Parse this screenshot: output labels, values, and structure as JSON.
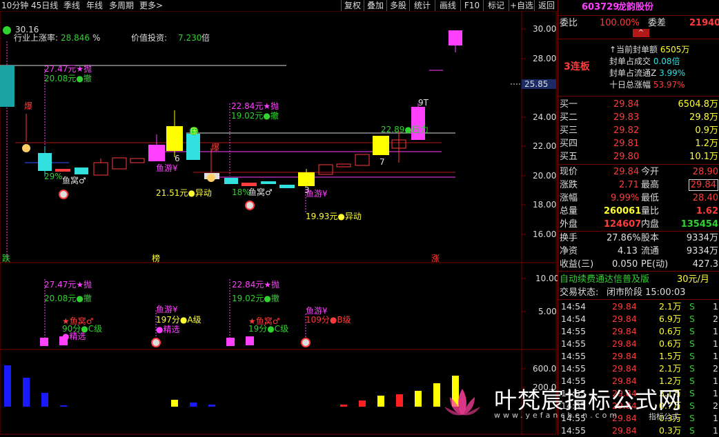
{
  "toolbar": {
    "left": [
      "10分钟",
      "45日线",
      "季线",
      "年线",
      "多周期",
      "更多>"
    ],
    "right": [
      "复权",
      "叠加",
      "多股",
      "统计",
      "画线",
      "F10",
      "标记",
      "+自选",
      "返回"
    ]
  },
  "main_chart": {
    "header": {
      "price_label": "30.16",
      "industry_label": "行业上涨率:",
      "industry_value": "28.846",
      "industry_unit": "%",
      "value_label": "价值投资:",
      "value_value": "7.230",
      "value_unit": "倍"
    },
    "y_axis": [
      "30.00",
      "28.00",
      "26.00",
      "24.00",
      "22.00",
      "20.00",
      "18.00",
      "16.00"
    ],
    "current_price_tag": "25.85",
    "annotations": [
      {
        "text": "27.47元★抛",
        "color": "#ff40ff"
      },
      {
        "text": "20.08元●撤",
        "color": "#2fd22f"
      },
      {
        "text": "爆",
        "color": "#ff3b3b"
      },
      {
        "text": "29%",
        "color": "#2fd22f"
      },
      {
        "text": "鱼窝♂",
        "color": "#e0e0e0"
      },
      {
        "text": "22.84元★抛",
        "color": "#ff40ff"
      },
      {
        "text": "19.02元●撤",
        "color": "#2fd22f"
      },
      {
        "text": "爆",
        "color": "#ff3b3b"
      },
      {
        "text": "鱼游¥",
        "color": "#ff40ff"
      },
      {
        "text": "6",
        "color": "#e0e0e0"
      },
      {
        "text": "21.51元●异动",
        "color": "#ffff33"
      },
      {
        "text": "18%",
        "color": "#2fd22f"
      },
      {
        "text": "鱼窝♂",
        "color": "#e0e0e0"
      },
      {
        "text": "3",
        "color": "#e0e0e0"
      },
      {
        "text": "鱼游¥",
        "color": "#ff40ff"
      },
      {
        "text": "19.93元●异动",
        "color": "#ffff33"
      },
      {
        "text": "22.89●压力",
        "color": "#2fd22f"
      },
      {
        "text": "7",
        "color": "#e0e0e0"
      },
      {
        "text": "9T",
        "color": "#e0e0e0"
      },
      {
        "text": "压",
        "color": "#ffff33"
      }
    ],
    "bottom_markers": [
      {
        "text": "跌",
        "color": "#2fd22f"
      },
      {
        "text": "榜",
        "color": "#ffff33"
      },
      {
        "text": "涨",
        "color": "#ff3b3b"
      }
    ]
  },
  "sub_chart1": {
    "y_axis": [
      "10.00",
      "5.00"
    ],
    "annotations": [
      {
        "text": "27.47元★抛",
        "color": "#ff40ff"
      },
      {
        "text": "20.08元●撤",
        "color": "#2fd22f"
      },
      {
        "text": "★鱼窝♂",
        "color": "#ff3b3b"
      },
      {
        "text": "90分●C级",
        "color": "#2fd22f"
      },
      {
        "text": "●精选",
        "color": "#ff40ff"
      },
      {
        "text": "鱼游¥",
        "color": "#ff40ff"
      },
      {
        "text": "197分●A级",
        "color": "#ffff33"
      },
      {
        "text": "●精选",
        "color": "#ff40ff"
      },
      {
        "text": "22.84元★抛",
        "color": "#ff40ff"
      },
      {
        "text": "19.02元●撤",
        "color": "#2fd22f"
      },
      {
        "text": "★鱼窝♂",
        "color": "#ff3b3b"
      },
      {
        "text": "19分●C级",
        "color": "#2fd22f"
      },
      {
        "text": "鱼游¥",
        "color": "#ff40ff"
      },
      {
        "text": "109分●B级",
        "color": "#ff3b3b"
      }
    ]
  },
  "sub_chart2": {
    "y_axis": [
      "600.0",
      "200.0"
    ]
  },
  "watermark": {
    "title": "叶梵宸指标公式网",
    "url": "www.yefanchen.com",
    "right_text": "指标公式"
  },
  "panel": {
    "code": "603729",
    "name": "龙韵股份",
    "weibi_label": "委比",
    "weibi_value": "100.00%",
    "weicha_label": "委差",
    "weicha_value": "21940",
    "streak": "3连板",
    "seal_info": [
      {
        "label": "↑当前封单额",
        "value": "6505万",
        "color": "#ffff33"
      },
      {
        "label": "封单占成交",
        "value": "0.08倍",
        "color": "#33e0e0"
      },
      {
        "label": "封单占流通Z",
        "value": "3.99%",
        "color": "#33e0e0"
      },
      {
        "label": "十日总涨幅",
        "value": "53.97%",
        "color": "#ff3b3b"
      }
    ],
    "bids": [
      {
        "label": "买一",
        "price": "29.84",
        "vol": "6504.8万"
      },
      {
        "label": "买二",
        "price": "29.83",
        "vol": "29.8万"
      },
      {
        "label": "买三",
        "price": "29.82",
        "vol": "0.9万"
      },
      {
        "label": "买四",
        "price": "29.81",
        "vol": "1.2万"
      },
      {
        "label": "买五",
        "price": "29.80",
        "vol": "10.1万"
      }
    ],
    "stats": [
      {
        "l1": "现价",
        "v1": "29.84",
        "c1": "#ff3b3b",
        "l2": "今开",
        "v2": "28.90",
        "c2": "#ff3b3b"
      },
      {
        "l1": "涨跌",
        "v1": "2.71",
        "c1": "#ff3b3b",
        "l2": "最高",
        "v2": "29.84",
        "c2": "#ff3b3b"
      },
      {
        "l1": "涨幅",
        "v1": "9.99%",
        "c1": "#ff3b3b",
        "l2": "最低",
        "v2": "28.40",
        "c2": "#ff3b3b"
      },
      {
        "l1": "总量",
        "v1": "260061",
        "c1": "#ffff33",
        "l2": "量比",
        "v2": "1.62",
        "c2": "#ff3b3b"
      },
      {
        "l1": "外盘",
        "v1": "124607",
        "c1": "#ff3b3b",
        "l2": "内盘",
        "v2": "135454",
        "c2": "#2fd22f"
      }
    ],
    "stats2": [
      {
        "l1": "换手",
        "v1": "27.86%",
        "l2": "股本",
        "v2": "9334万"
      },
      {
        "l1": "净资",
        "v1": "4.13",
        "l2": "流通",
        "v2": "9334万"
      },
      {
        "l1": "收益(三)",
        "v1": "0.050",
        "l2": "PE(动)",
        "v2": "427.3"
      }
    ],
    "promo_text": "自动续费通达信普及版",
    "promo_price": "30元/月",
    "status_label": "交易状态:",
    "status_value": "闭市阶段 15:00:03",
    "ticks": [
      {
        "t": "14:54",
        "p": "29.84",
        "v": "2.1万",
        "s": "S",
        "n": "1"
      },
      {
        "t": "14:54",
        "p": "29.84",
        "v": "6.9万",
        "s": "S",
        "n": "2"
      },
      {
        "t": "14:55",
        "p": "29.84",
        "v": "0.6万",
        "s": "S",
        "n": "1"
      },
      {
        "t": "14:55",
        "p": "29.84",
        "v": "0.6万",
        "s": "S",
        "n": "1"
      },
      {
        "t": "14:55",
        "p": "29.84",
        "v": "1.5万",
        "s": "S",
        "n": "1"
      },
      {
        "t": "14:55",
        "p": "29.84",
        "v": "2.1万",
        "s": "S",
        "n": "2"
      },
      {
        "t": "14:55",
        "p": "29.84",
        "v": "1.2万",
        "s": "S",
        "n": "1"
      },
      {
        "t": "14:55",
        "p": "29.84",
        "v": "3.1万",
        "s": "S",
        "n": "1"
      },
      {
        "t": "14:55",
        "p": "29.84",
        "v": "0.7万",
        "s": "S",
        "n": "2"
      },
      {
        "t": "14:55",
        "p": "29.84",
        "v": "0.3万",
        "s": "S",
        "n": "1"
      },
      {
        "t": "14:55",
        "p": "29.84",
        "v": "0.3万",
        "s": "S",
        "n": "1"
      }
    ]
  }
}
